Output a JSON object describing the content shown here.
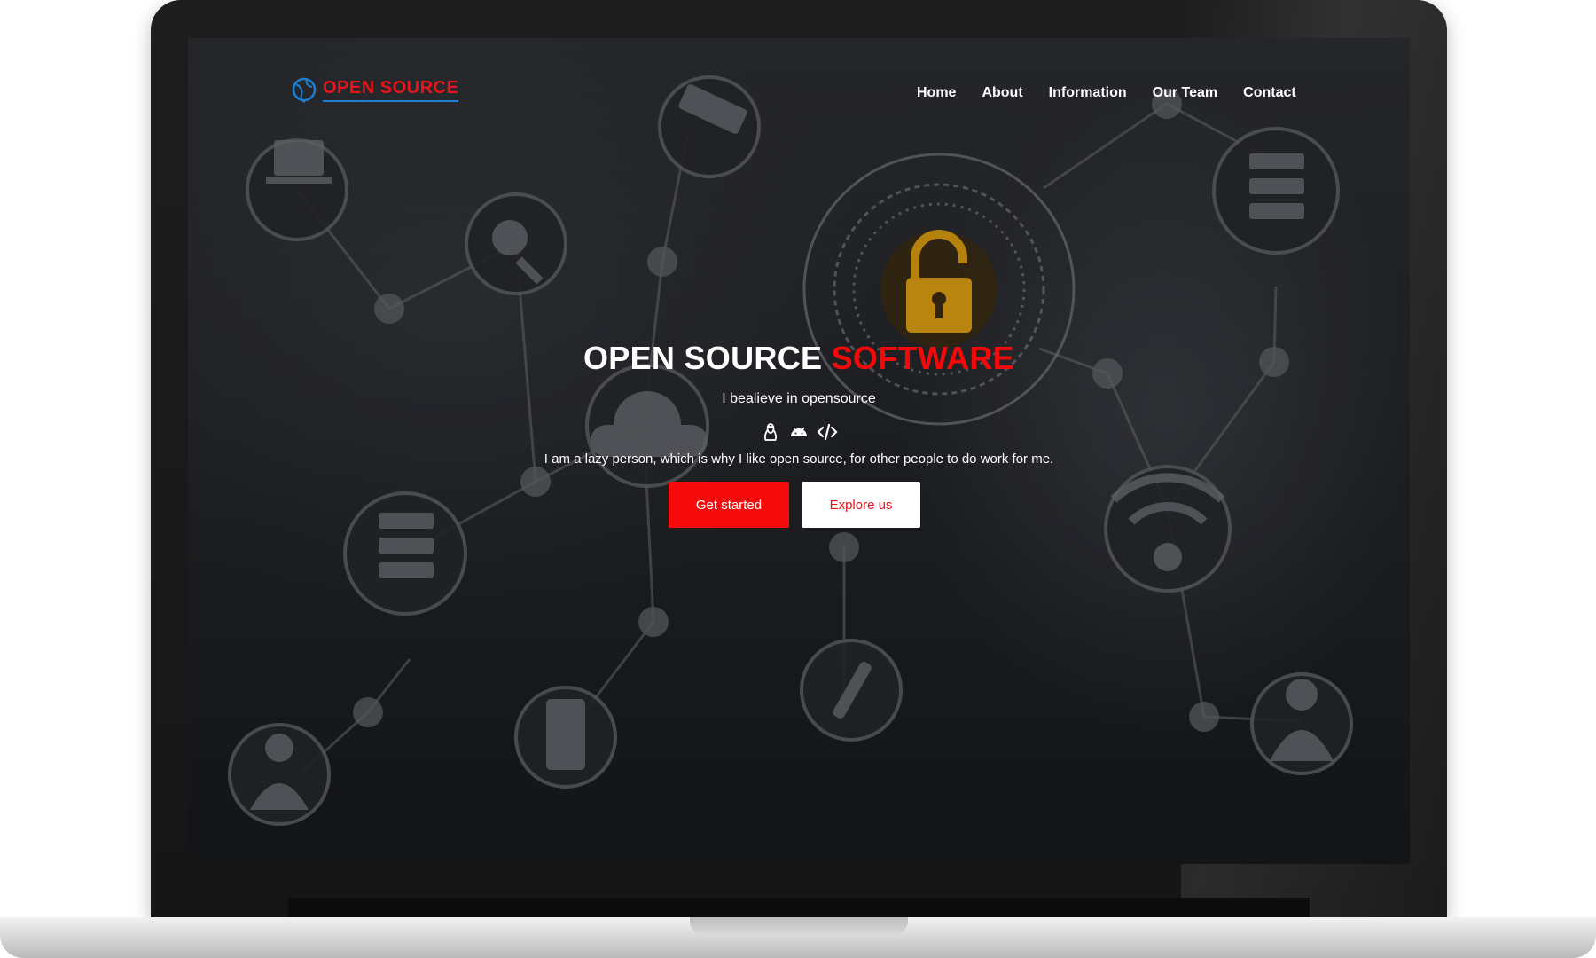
{
  "brand": {
    "name": "OPEN SOURCE",
    "text_color": "#e8141c",
    "underline_color": "#1d7fd1"
  },
  "nav": {
    "items": [
      {
        "label": "Home"
      },
      {
        "label": "About"
      },
      {
        "label": "Information"
      },
      {
        "label": "Our Team"
      },
      {
        "label": "Contact"
      }
    ]
  },
  "hero": {
    "title_main": "OPEN SOURCE",
    "title_accent": "SOFTWARE",
    "accent_color": "#f20a0a",
    "tagline": "I bealieve in opensource",
    "icons": [
      "linux-icon",
      "android-icon",
      "code-icon"
    ],
    "description": "I am a lazy person, which is why I like open source, for other people to do work for me.",
    "primary_button": "Get started",
    "secondary_button": "Explore us"
  },
  "background": {
    "theme": "network-security",
    "node_icons": [
      "laptop-lock-icon",
      "magnifier-lock-icon",
      "security-camera-icon",
      "padlock-icon",
      "cloud-server-icon",
      "cloud-upload-icon",
      "wifi-icon",
      "wrench-icon",
      "phone-lock-icon",
      "woman-user-icon",
      "man-user-icon"
    ]
  }
}
